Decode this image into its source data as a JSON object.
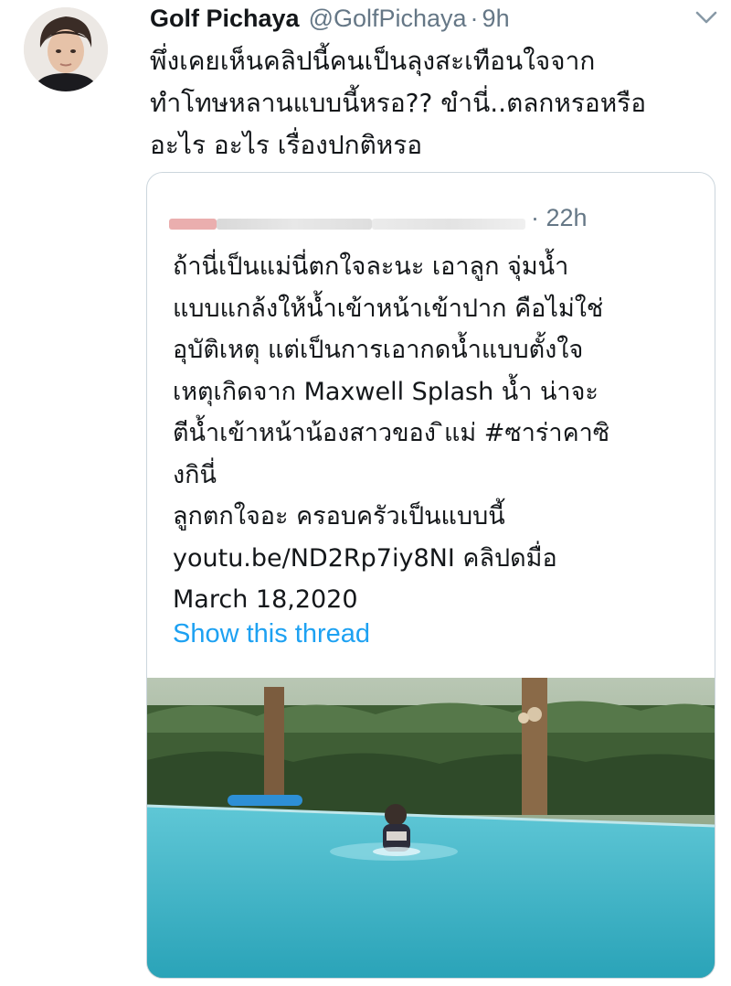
{
  "tweet": {
    "author_name": "Golf Pichaya",
    "author_handle": "@GolfPichaya",
    "separator": "·",
    "time": "9h",
    "text": "พึ่งเคยเห็นคลิปนี้คนเป็นลุงสะเทือนใจจาก\nทำโทษหลานแบบนี้หรอ?? ขำนี่..ตลกหรอหรือ\nอะไร อะไร เรื่องปกติหรอ"
  },
  "quoted_tweet": {
    "time": "· 22h",
    "text": "ถ้านี่เป็นแม่นี่ตกใจละนะ เอาลูก จุ่มน้ำ\nแบบแกล้งให้น้ำเข้าหน้าเข้าปาก คือไม่ใช่\nอุบัติเหตุ แต่เป็นการเอากดน้ำแบบตั้งใจ\nเหตุเกิดจาก Maxwell Splash น้ำ น่าจะ\nตีน้ำเข้าหน้าน้องสาวของ  ิแม่ #ซาร่าคาซิ\nงกินี่\nลูกตกใจอะ ครอบครัวเป็นแบบนี้\nyoutu.be/ND2Rp7iy8NI  คลิปดมื่อ\nMarch 18,2020",
    "show_thread_label": "Show this thread"
  },
  "colors": {
    "text": "#14171a",
    "secondary": "#657786",
    "link": "#1da1f2",
    "border": "#ccd6dd",
    "pool": "#3fb3c6"
  },
  "icons": {
    "more": "chevron-down-icon"
  }
}
